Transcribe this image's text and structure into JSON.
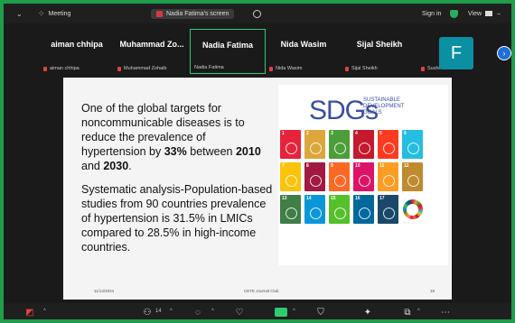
{
  "topbar": {
    "meeting_label": "Meeting",
    "share_label": "Nadia Fatima's screen",
    "signin_label": "Sign in",
    "view_label": "View"
  },
  "participants": [
    {
      "name": "aiman chhipa",
      "label": "aiman chhipa"
    },
    {
      "name": "Muhammad  Zo...",
      "label": "Muhammad Zohaib"
    },
    {
      "name": "Nadia Fatima",
      "label": "Nadia Fatima"
    },
    {
      "name": "Nida Wasim",
      "label": "Nida Wasim"
    },
    {
      "name": "Sijal Sheikh",
      "label": "Sijal Sheikh"
    },
    {
      "name": "",
      "label": "Sushi Rizvi",
      "avatar": "F"
    }
  ],
  "slide": {
    "para1_pre": "One of the global targets for noncommunicable diseases is to reduce the prevalence of hypertension by ",
    "para1_pct": "33%",
    "para1_mid": " between ",
    "para1_y1": "2010",
    "para1_and": " and ",
    "para1_y2": "2030",
    "para1_end": ".",
    "para2": "Systematic analysis-Population-based studies from 90 countries prevalence of hypertension is 31.5% in LMICs compared to 28.5% in high-income countries.",
    "footer_date": "11/14/2024",
    "footer_center": "CETE Journal Club",
    "footer_page": "18",
    "sdg_title": "SDGs",
    "sdg_sub1": "SUSTAINABLE",
    "sdg_sub2": "DEVELOPMENT",
    "sdg_sub3": "GOALS",
    "sdg_colors": [
      "#e5243b",
      "#dda63a",
      "#4c9f38",
      "#c5192d",
      "#ff3a21",
      "#26bde2",
      "#fcc30b",
      "#a21942",
      "#fd6925",
      "#dd1367",
      "#fd9d24",
      "#bf8b2e",
      "#3f7e44",
      "#0a97d9",
      "#56c02b",
      "#00689d",
      "#19486a"
    ]
  },
  "toolbar": {
    "participants_count": "14"
  },
  "colors": {
    "active_border": "#1e9e4a",
    "avatar_bg": "#0a8fa3"
  }
}
